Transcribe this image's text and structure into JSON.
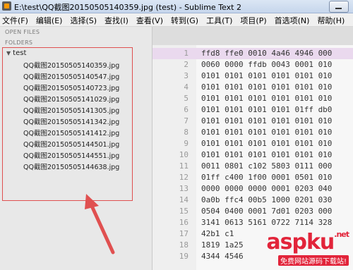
{
  "window": {
    "title": "E:\\test\\QQ截图20150505140359.jpg (test) - Sublime Text 2"
  },
  "menu": [
    "文件(F)",
    "编辑(E)",
    "选择(S)",
    "查找(I)",
    "查看(V)",
    "转到(G)",
    "工具(T)",
    "项目(P)",
    "首选项(N)",
    "帮助(H)"
  ],
  "sidebar": {
    "open_files_label": "OPEN FILES",
    "folders_label": "FOLDERS",
    "folder_name": "test",
    "files": [
      "QQ截图20150505140359.jpg",
      "QQ截图20150505140547.jpg",
      "QQ截图20150505140723.jpg",
      "QQ截图20150505141029.jpg",
      "QQ截图20150505141305.jpg",
      "QQ截图20150505141342.jpg",
      "QQ截图20150505141412.jpg",
      "QQ截图20150505144501.jpg",
      "QQ截图20150505144551.jpg",
      "QQ截图20150505144638.jpg"
    ]
  },
  "editor": {
    "lines": [
      {
        "n": "1",
        "text": "ffd8 ffe0 0010 4a46 4946 000"
      },
      {
        "n": "2",
        "text": "0060 0000 ffdb 0043 0001 010"
      },
      {
        "n": "3",
        "text": "0101 0101 0101 0101 0101 010"
      },
      {
        "n": "4",
        "text": "0101 0101 0101 0101 0101 010"
      },
      {
        "n": "5",
        "text": "0101 0101 0101 0101 0101 010"
      },
      {
        "n": "6",
        "text": "0101 0101 0101 0101 01ff db0"
      },
      {
        "n": "7",
        "text": "0101 0101 0101 0101 0101 010"
      },
      {
        "n": "8",
        "text": "0101 0101 0101 0101 0101 010"
      },
      {
        "n": "9",
        "text": "0101 0101 0101 0101 0101 010"
      },
      {
        "n": "10",
        "text": "0101 0101 0101 0101 0101 010"
      },
      {
        "n": "11",
        "text": "0011 0801 c102 5803 0111 000"
      },
      {
        "n": "12",
        "text": "01ff c400 1f00 0001 0501 010"
      },
      {
        "n": "13",
        "text": "0000 0000 0000 0001 0203 040"
      },
      {
        "n": "14",
        "text": "0a0b ffc4 00b5 1000 0201 030"
      },
      {
        "n": "15",
        "text": "0504 0400 0001 7d01 0203 000"
      },
      {
        "n": "16",
        "text": "3141 0613 5161 0722 7114 328"
      },
      {
        "n": "17",
        "text": "42b1 c1"
      },
      {
        "n": "18",
        "text": "1819 1a25"
      },
      {
        "n": "19",
        "text": "4344 4546"
      }
    ]
  },
  "watermark": {
    "main": "asp",
    "ku": "ku",
    "dotnet": ".net",
    "sub": "免费网站源码下载站!"
  }
}
